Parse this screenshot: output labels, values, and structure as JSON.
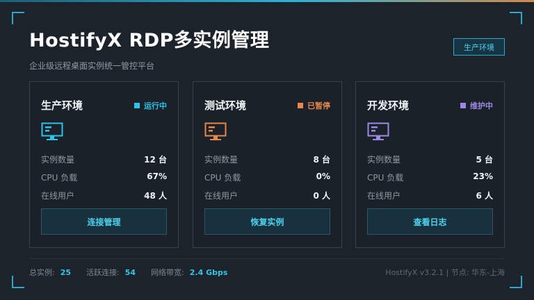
{
  "header": {
    "title": "HostifyX RDP多实例管理",
    "subtitle": "企业级远程桌面实例统一管控平台",
    "environment_badge": "生产环境"
  },
  "cards": [
    {
      "name": "生产环境",
      "status": "运行中",
      "status_color": "#2bc4ea",
      "icon": "monitor-icon",
      "stats": [
        {
          "label": "实例数量",
          "value": "12 台"
        },
        {
          "label": "CPU 负载",
          "value": "67%"
        },
        {
          "label": "在线用户",
          "value": "48 人"
        }
      ],
      "button": "连接管理"
    },
    {
      "name": "测试环境",
      "status": "已暂停",
      "status_color": "#e8874a",
      "icon": "monitor-icon",
      "stats": [
        {
          "label": "实例数量",
          "value": "8 台"
        },
        {
          "label": "CPU 负载",
          "value": "0%"
        },
        {
          "label": "在线用户",
          "value": "0 人"
        }
      ],
      "button": "恢复实例"
    },
    {
      "name": "开发环境",
      "status": "维护中",
      "status_color": "#9d88e4",
      "icon": "monitor-icon",
      "stats": [
        {
          "label": "实例数量",
          "value": "5 台"
        },
        {
          "label": "CPU 负载",
          "value": "23%"
        },
        {
          "label": "在线用户",
          "value": "6 人"
        }
      ],
      "button": "查看日志"
    }
  ],
  "footer": {
    "total_label": "总实例:",
    "total_value": "25",
    "active_label": "活跃连接:",
    "active_value": "54",
    "bandwidth_label": "网络带宽:",
    "bandwidth_value": "2.4 Gbps",
    "version": "HostifyX v3.2.1 | 节点: 华东-上海"
  },
  "colors": {
    "accent": "#2bc4ea",
    "background": "#1c232b",
    "card_border": "#39424d"
  }
}
